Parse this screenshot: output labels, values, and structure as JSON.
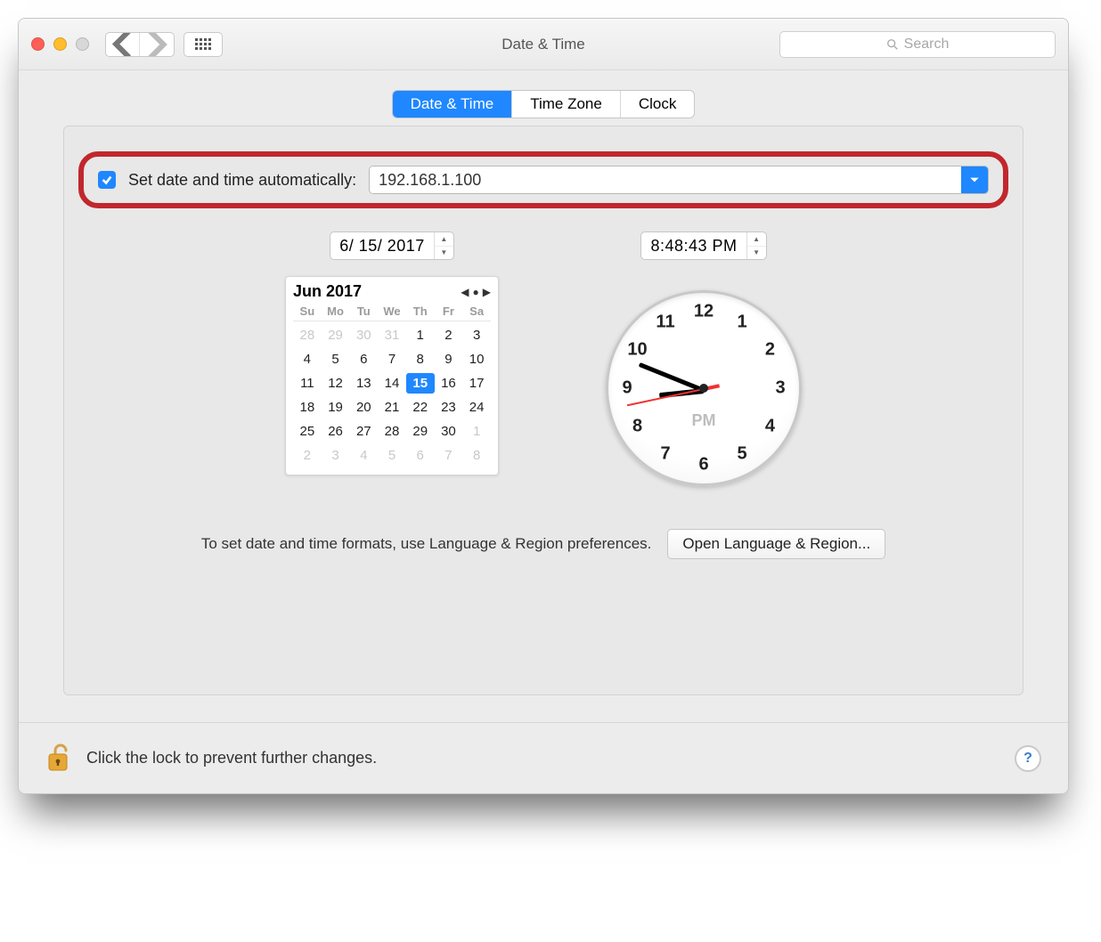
{
  "window": {
    "title": "Date & Time"
  },
  "search": {
    "placeholder": "Search"
  },
  "tabs": {
    "items": [
      "Date & Time",
      "Time Zone",
      "Clock"
    ],
    "active_index": 0
  },
  "autoset": {
    "checked": true,
    "label": "Set date and time automatically:",
    "server": "192.168.1.100"
  },
  "date_field": "6/ 15/ 2017",
  "time_field": "8:48:43 PM",
  "calendar": {
    "month_label": "Jun 2017",
    "dow": [
      "Su",
      "Mo",
      "Tu",
      "We",
      "Th",
      "Fr",
      "Sa"
    ],
    "leading": [
      28,
      29,
      30,
      31
    ],
    "days": [
      1,
      2,
      3,
      4,
      5,
      6,
      7,
      8,
      9,
      10,
      11,
      12,
      13,
      14,
      15,
      16,
      17,
      18,
      19,
      20,
      21,
      22,
      23,
      24,
      25,
      26,
      27,
      28,
      29,
      30
    ],
    "trailing": [
      1,
      2,
      3,
      4,
      5,
      6,
      7,
      8
    ],
    "selected": 15
  },
  "clock": {
    "ampm": "PM",
    "numbers": [
      "12",
      "1",
      "2",
      "3",
      "4",
      "5",
      "6",
      "7",
      "8",
      "9",
      "10",
      "11"
    ],
    "hour_angle": 174,
    "minute_angle": 202,
    "second_angle": 168
  },
  "formats": {
    "text": "To set date and time formats, use Language & Region preferences.",
    "button": "Open Language & Region..."
  },
  "footer": {
    "lock_text": "Click the lock to prevent further changes."
  }
}
